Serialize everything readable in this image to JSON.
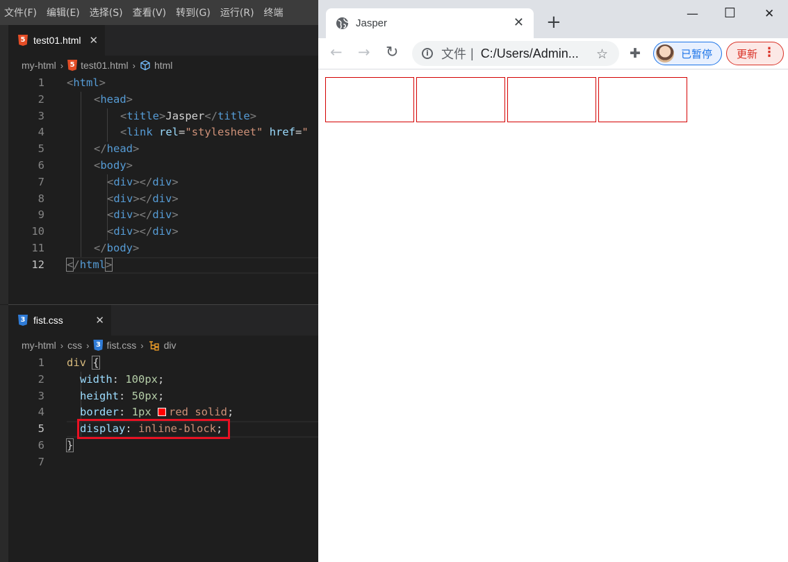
{
  "menubar": {
    "items": [
      "文件(F)",
      "编辑(E)",
      "选择(S)",
      "查看(V)",
      "转到(G)",
      "运行(R)",
      "终端"
    ]
  },
  "editor1": {
    "tab": {
      "label": "test01.html",
      "close": "✕"
    },
    "breadcrumb": {
      "root": "my-html",
      "file": "test01.html",
      "symbol": "html"
    },
    "lines": [
      {
        "n": "1"
      },
      {
        "n": "2"
      },
      {
        "n": "3"
      },
      {
        "n": "4"
      },
      {
        "n": "5"
      },
      {
        "n": "6"
      },
      {
        "n": "7"
      },
      {
        "n": "8"
      },
      {
        "n": "9"
      },
      {
        "n": "10"
      },
      {
        "n": "11"
      },
      {
        "n": "12"
      }
    ],
    "code": {
      "html_open": "html",
      "head_open": "head",
      "title_tag": "title",
      "title_text": "Jasper",
      "link_tag": "link",
      "rel_attr": "rel",
      "rel_value": "\"stylesheet\"",
      "href_attr": "href",
      "href_value": "\"",
      "head_close": "head",
      "body_open": "body",
      "div_tag": "div",
      "body_close": "body",
      "html_close": "html"
    }
  },
  "editor2": {
    "tab": {
      "label": "fist.css",
      "close": "✕"
    },
    "breadcrumb": {
      "root": "my-html",
      "folder": "css",
      "file": "fist.css",
      "symbol": "div"
    },
    "lines": [
      {
        "n": "1"
      },
      {
        "n": "2"
      },
      {
        "n": "3"
      },
      {
        "n": "4"
      },
      {
        "n": "5"
      },
      {
        "n": "6"
      },
      {
        "n": "7"
      }
    ],
    "code": {
      "selector": "div",
      "width_prop": "width",
      "width_val": "100px",
      "height_prop": "height",
      "height_val": "50px",
      "border_prop": "border",
      "border_num": "1px",
      "border_rest": "red solid",
      "display_prop": "display",
      "display_val": "inline-block"
    }
  },
  "browser": {
    "tab_title": "Jasper",
    "tab_close": "✕",
    "new_tab": "+",
    "window": {
      "minimize": "—",
      "maximize": "☐",
      "close": "✕"
    },
    "nav": {
      "back": "←",
      "forward": "→",
      "reload": "↻"
    },
    "omnibox": {
      "info": "i",
      "scheme_label": "文件",
      "separator": "|",
      "url": "C:/Users/Admin..."
    },
    "star": "☆",
    "extensions": "✚",
    "profile_label": "已暂停",
    "update_label": "更新",
    "menu_dots": "⋮"
  },
  "colors": {
    "red_border": "#d40000",
    "highlight_box": "#e81123",
    "profile_blue": "#1a73e8",
    "update_red": "#d93025"
  }
}
